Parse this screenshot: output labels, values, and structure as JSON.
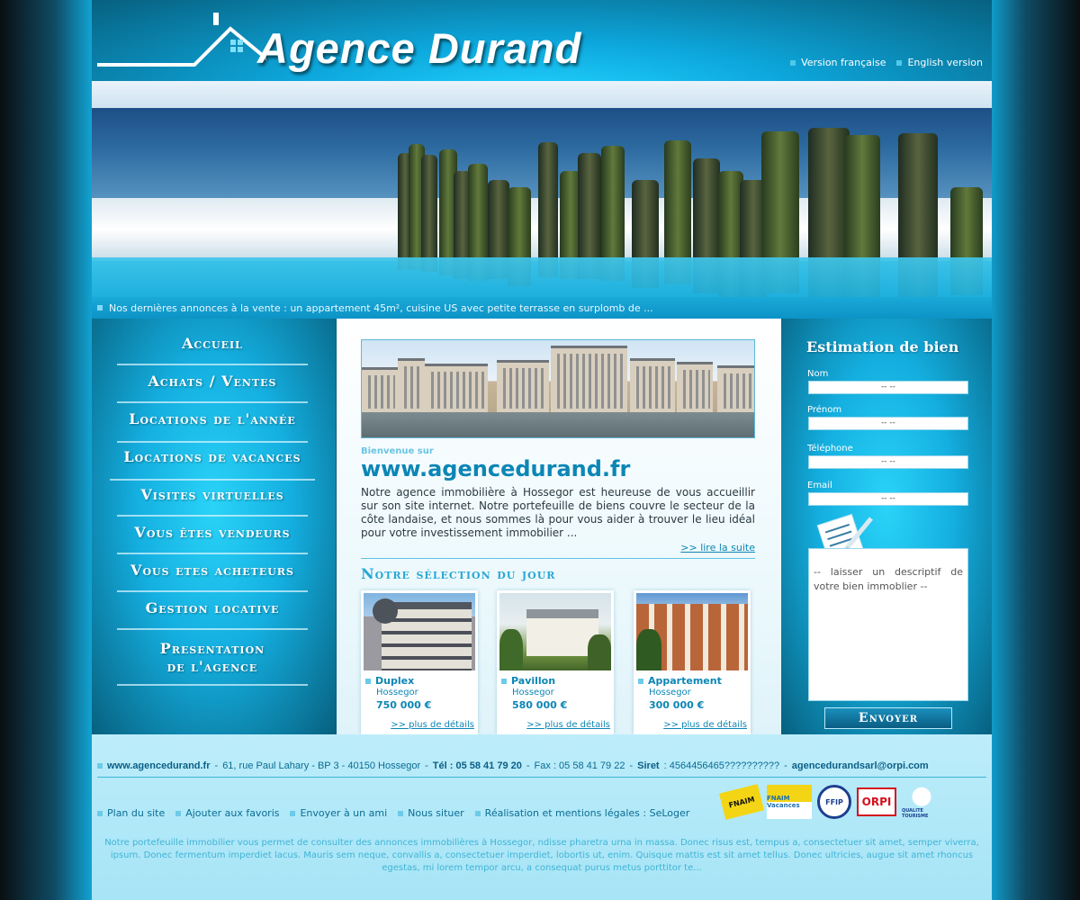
{
  "header": {
    "logo_text": "Agence Durand",
    "lang_fr": "Version française",
    "lang_en": "English version"
  },
  "ticker": {
    "text": "Nos dernières annonces à la vente : un appartement 45m², cuisine US avec petite terrasse en surplomb de ..."
  },
  "nav": {
    "items": [
      "Accueil",
      "Achats / Ventes",
      "Locations de l'année",
      "Locations de vacances",
      "Visites virtuelles",
      "Vous êtes vendeurs",
      "Vous etes acheteurs",
      "Gestion locative",
      "Presentation",
      "de l'agence"
    ]
  },
  "content": {
    "welcome_small": "Bienvenue sur",
    "welcome_url": "www.agencedurand.fr",
    "welcome_text": "Notre agence immobilière à Hossegor est heureuse de vous accueillir sur son site internet. Notre portefeuille de biens couvre le secteur de la côte landaise, et nous sommes là pour vous aider à trouver le lieu idéal pour votre investissement immobilier ...",
    "read_more": ">> lire la suite",
    "selection_title": "Notre sélection du jour",
    "cards": [
      {
        "type": "Duplex",
        "city": "Hossegor",
        "price": "750 000 €",
        "details": ">> plus de détails"
      },
      {
        "type": "Pavillon",
        "city": "Hossegor",
        "price": "580 000 €",
        "details": ">> plus de détails"
      },
      {
        "type": "Appartement",
        "city": "Hossegor",
        "price": "300 000 €",
        "details": ">> plus de détails"
      }
    ]
  },
  "form": {
    "title": "Estimation de bien",
    "fields": [
      {
        "label": "Nom",
        "value": "-- --"
      },
      {
        "label": "Prénom",
        "value": "-- --"
      },
      {
        "label": "Téléphone",
        "value": "-- --"
      },
      {
        "label": "Email",
        "value": "-- --"
      }
    ],
    "textarea": "-- laisser un descriptif de votre bien immoblier --",
    "submit": "Envoyer"
  },
  "footer": {
    "site": "www.agencedurand.fr",
    "address": "61, rue Paul Lahary - BP 3 - 40150 Hossegor",
    "tel": "Tél : 05 58 41 79 20",
    "fax": "Fax : 05 58 41 79 22",
    "siret_label": "Siret",
    "siret_value": ": 4564456465??????????",
    "email": "agencedurandsarl@orpi.com",
    "links": [
      "Plan du site",
      "Ajouter aux favoris",
      "Envoyer à un ami",
      "Nous situer",
      "Réalisation et mentions légales : SeLoger"
    ],
    "badges": [
      "FNAIM",
      "FNAIM Vacances",
      "FFIP",
      "ORPI",
      "QUALITE TOURISME"
    ],
    "text": "Notre portefeuille immobilier vous permet de consulter des annonces immobilières à Hossegor, ndisse pharetra urna in massa. Donec risus est, tempus a, consectetuer sit amet, semper viverra, ipsum. Donec fermentum imperdiet lacus. Mauris sem neque, convallis a, consectetuer imperdiet, lobortis ut, enim. Quisque mattis est sit amet tellus. Donec ultricies, augue sit amet rhoncus egestas, mi lorem tempor arcu, a consequat purus metus porttitor te..."
  },
  "colors": {
    "accent": "#0c86b5",
    "panel": "#14afe0",
    "footer_bg": "#bdedfa"
  }
}
